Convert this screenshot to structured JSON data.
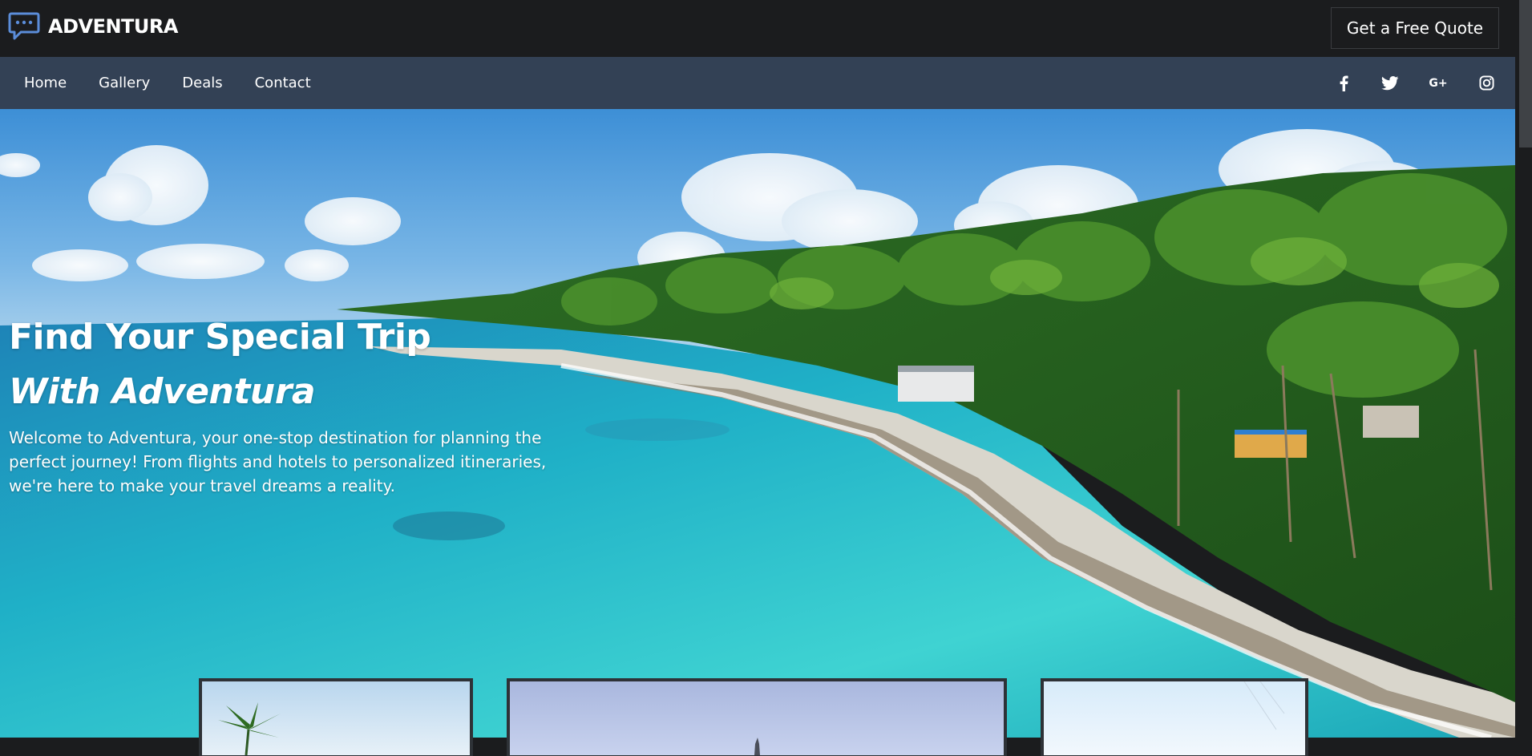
{
  "header": {
    "brand": "ADVENTURA",
    "logo_icon": "chat-bubble-icon",
    "cta_label": "Get a Free Quote"
  },
  "nav": {
    "items": [
      {
        "label": "Home"
      },
      {
        "label": "Gallery"
      },
      {
        "label": "Deals"
      },
      {
        "label": "Contact"
      }
    ],
    "social_icons": [
      "facebook-icon",
      "twitter-icon",
      "google-plus-icon",
      "instagram-icon"
    ],
    "google_plus_label": "G+"
  },
  "hero": {
    "title": "Find Your Special Trip",
    "subtitle": "With Adventura",
    "description": "Welcome to Adventura, your one-stop destination for planning the perfect journey! From flights and hotels to personalized itineraries, we're here to make your travel dreams a reality."
  },
  "colors": {
    "topbar_bg": "#1b1c1e",
    "navbar_bg": "#334155",
    "logo_accent": "#5b8dd9",
    "text": "#ffffff"
  }
}
